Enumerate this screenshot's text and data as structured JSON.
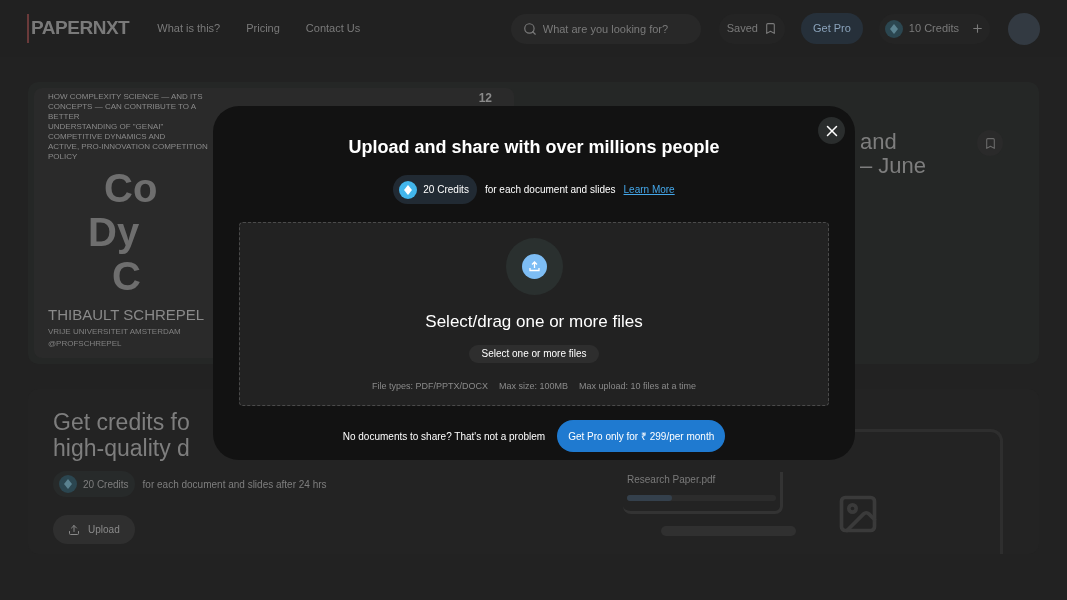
{
  "navbar": {
    "logo": "PAPERNXT",
    "links": [
      "What is this?",
      "Pricing",
      "Contact Us"
    ],
    "search": {
      "placeholder": "What are you looking for?"
    },
    "saved": "Saved",
    "get_pro": "Get Pro",
    "credits": "10 Credits"
  },
  "featured": {
    "slide": {
      "lines": [
        "HOW COMPLEXITY SCIENCE — AND ITS CONCEPTS — CAN CONTRIBUTE TO A BETTER",
        "UNDERSTANDING OF \"GENAI\" COMPETITIVE DYNAMICS AND",
        "ACTIVE, PRO-INNOVATION COMPETITION POLICY"
      ],
      "page_count": "12",
      "big_letters": [
        "Co",
        "Dy",
        "C"
      ],
      "author": "THIBAULT SCHREPEL",
      "affiliation": "VRIJE UNIVERSITEIT AMSTERDAM",
      "handle": "@PROFSCHREPEL"
    },
    "title_lines": [
      "and",
      "– June"
    ]
  },
  "promo": {
    "title_lines": [
      "Get credits fo",
      "high-quality d"
    ],
    "credits": "20 Credits",
    "note": "for each document and slides after 24 hrs",
    "upload": "Upload",
    "file": {
      "name": "Research Paper.pdf",
      "level": 0.3
    }
  },
  "modal": {
    "title": "Upload and share with over millions people",
    "credits": "20 Credits",
    "credits_note": "for each document and slides",
    "learn_more": "Learn More",
    "drop_title": "Select/drag one or more files",
    "select_button": "Select one or more files",
    "limits": [
      "File types: PDF/PPTX/DOCX",
      "Max size: 100MB",
      "Max upload: 10 files at a time"
    ],
    "footer_note": "No documents to share? That's not a problem",
    "cta": "Get Pro only for ₹ 299/per month"
  }
}
